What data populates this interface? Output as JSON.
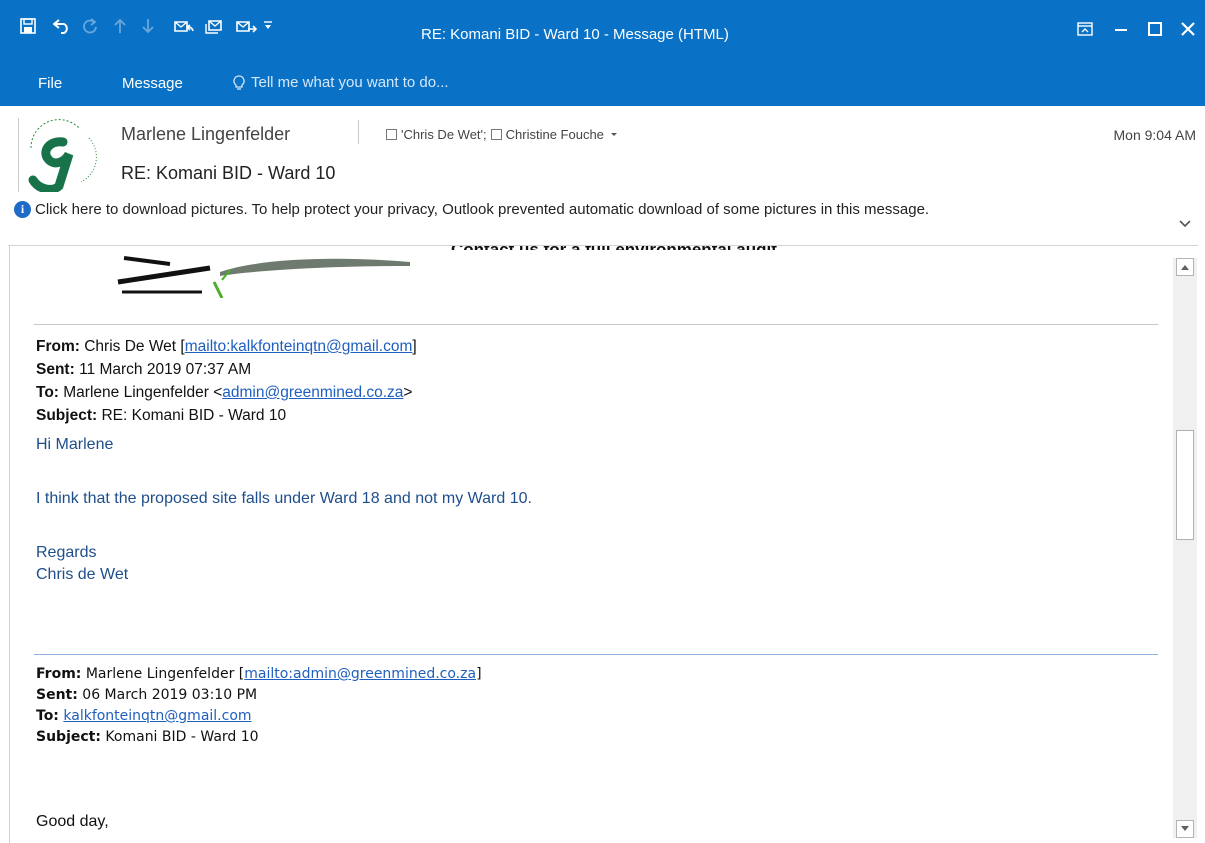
{
  "window": {
    "title": "RE: Komani BID - Ward 10 - Message (HTML)"
  },
  "quick_access": {
    "icons": [
      "save-icon",
      "undo-icon",
      "redo-icon",
      "previous-item-icon",
      "next-item-icon",
      "reply-icon",
      "reply-all-icon",
      "forward-icon",
      "customize-qat-icon"
    ]
  },
  "menu": {
    "file": "File",
    "message": "Message",
    "tell_me": "Tell me what you want to do..."
  },
  "message": {
    "sender": "Marlene Lingenfelder",
    "recipient_1": "'Chris De Wet';",
    "recipient_2": "Christine Fouche",
    "time": "Mon 9:04 AM",
    "subject": "RE: Komani BID - Ward 10"
  },
  "infobar": {
    "text": "Click here to download pictures. To help protect your privacy, Outlook prevented automatic download of some pictures in this message."
  },
  "body": {
    "banner_text": "Contact us for a full environmental audit.",
    "reply1": {
      "from_label": "From:",
      "from_name": "Chris De Wet [",
      "from_link": "mailto:kalkfonteinqtn@gmail.com",
      "from_close": "]",
      "sent_label": "Sent:",
      "sent_value": "11 March 2019 07:37 AM",
      "to_label": "To:",
      "to_name": "Marlene Lingenfelder <",
      "to_link": "admin@greenmined.co.za",
      "to_close": ">",
      "subject_label": "Subject:",
      "subject_value": "RE: Komani BID - Ward 10"
    },
    "reply_greeting": "Hi Marlene",
    "reply_line": "I think that the proposed site falls under Ward 18 and not my Ward 10.",
    "reply_regards": "Regards",
    "reply_signature": "Chris de Wet",
    "reply2": {
      "from_label": "From:",
      "from_name": "Marlene Lingenfelder [",
      "from_link": "mailto:admin@greenmined.co.za",
      "from_close": "]",
      "sent_label": "Sent:",
      "sent_value": "06 March 2019 03:10 PM",
      "to_label": "To:",
      "to_link": "kalkfonteinqtn@gmail.com",
      "subject_label": "Subject:",
      "subject_value": "Komani BID - Ward 10"
    },
    "good_day": "Good day,"
  },
  "colors": {
    "title_bar": "#0a72c6",
    "link": "#1f5fbf",
    "reply_text": "#1f4e8c"
  }
}
